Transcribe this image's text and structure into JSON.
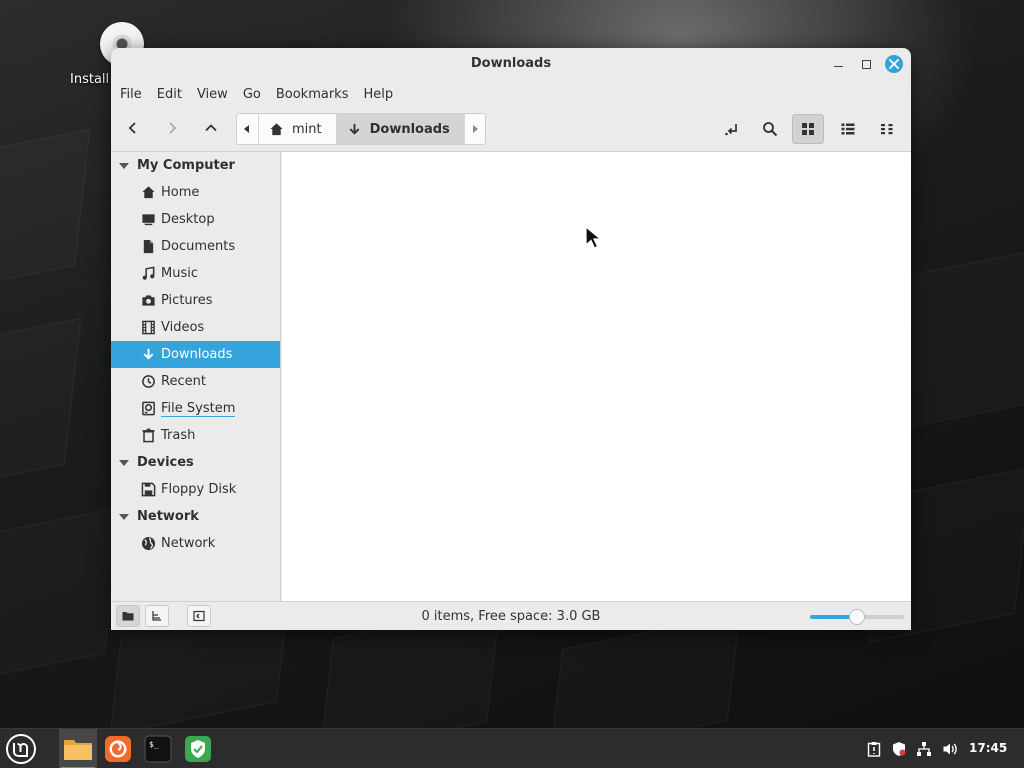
{
  "desktop": {
    "icons": [
      {
        "label": "Install",
        "icon": "disc-icon"
      }
    ]
  },
  "window": {
    "title": "Downloads",
    "controls": {
      "minimize": "minimize-icon",
      "maximize": "maximize-icon",
      "close": "close-icon"
    },
    "accent_color": "#35a4dc"
  },
  "menubar": {
    "items": [
      "File",
      "Edit",
      "View",
      "Go",
      "Bookmarks",
      "Help"
    ]
  },
  "toolbar": {
    "nav": [
      "back-icon",
      "forward-icon",
      "up-icon"
    ],
    "breadcrumbs": [
      {
        "label": "mint",
        "icon": "home-icon"
      },
      {
        "label": "Downloads",
        "icon": "download-icon",
        "active": true
      }
    ],
    "tools": [
      "toggle-location-icon",
      "search-icon",
      "icon-view-icon",
      "list-view-icon",
      "compact-view-icon"
    ]
  },
  "sidebar": {
    "sections": [
      {
        "label": "My Computer",
        "items": [
          {
            "label": "Home",
            "icon": "home-icon"
          },
          {
            "label": "Desktop",
            "icon": "desktop-icon"
          },
          {
            "label": "Documents",
            "icon": "document-icon"
          },
          {
            "label": "Music",
            "icon": "music-icon"
          },
          {
            "label": "Pictures",
            "icon": "camera-icon"
          },
          {
            "label": "Videos",
            "icon": "film-icon"
          },
          {
            "label": "Downloads",
            "icon": "download-icon",
            "selected": true
          },
          {
            "label": "Recent",
            "icon": "clock-icon"
          },
          {
            "label": "File System",
            "icon": "drive-icon"
          },
          {
            "label": "Trash",
            "icon": "trash-icon"
          }
        ]
      },
      {
        "label": "Devices",
        "items": [
          {
            "label": "Floppy Disk",
            "icon": "floppy-icon"
          }
        ]
      },
      {
        "label": "Network",
        "items": [
          {
            "label": "Network",
            "icon": "globe-icon"
          }
        ]
      }
    ]
  },
  "statusbar": {
    "text": "0 items, Free space: 3.0 GB",
    "zoom_level": 0.5
  },
  "taskbar": {
    "apps": [
      "mint-menu-icon",
      "files-icon",
      "firefox-icon",
      "terminal-icon",
      "shield-icon"
    ],
    "tray": [
      "clipboard-icon",
      "update-shield-icon",
      "network-icon",
      "volume-icon"
    ],
    "clock": "17:45"
  }
}
